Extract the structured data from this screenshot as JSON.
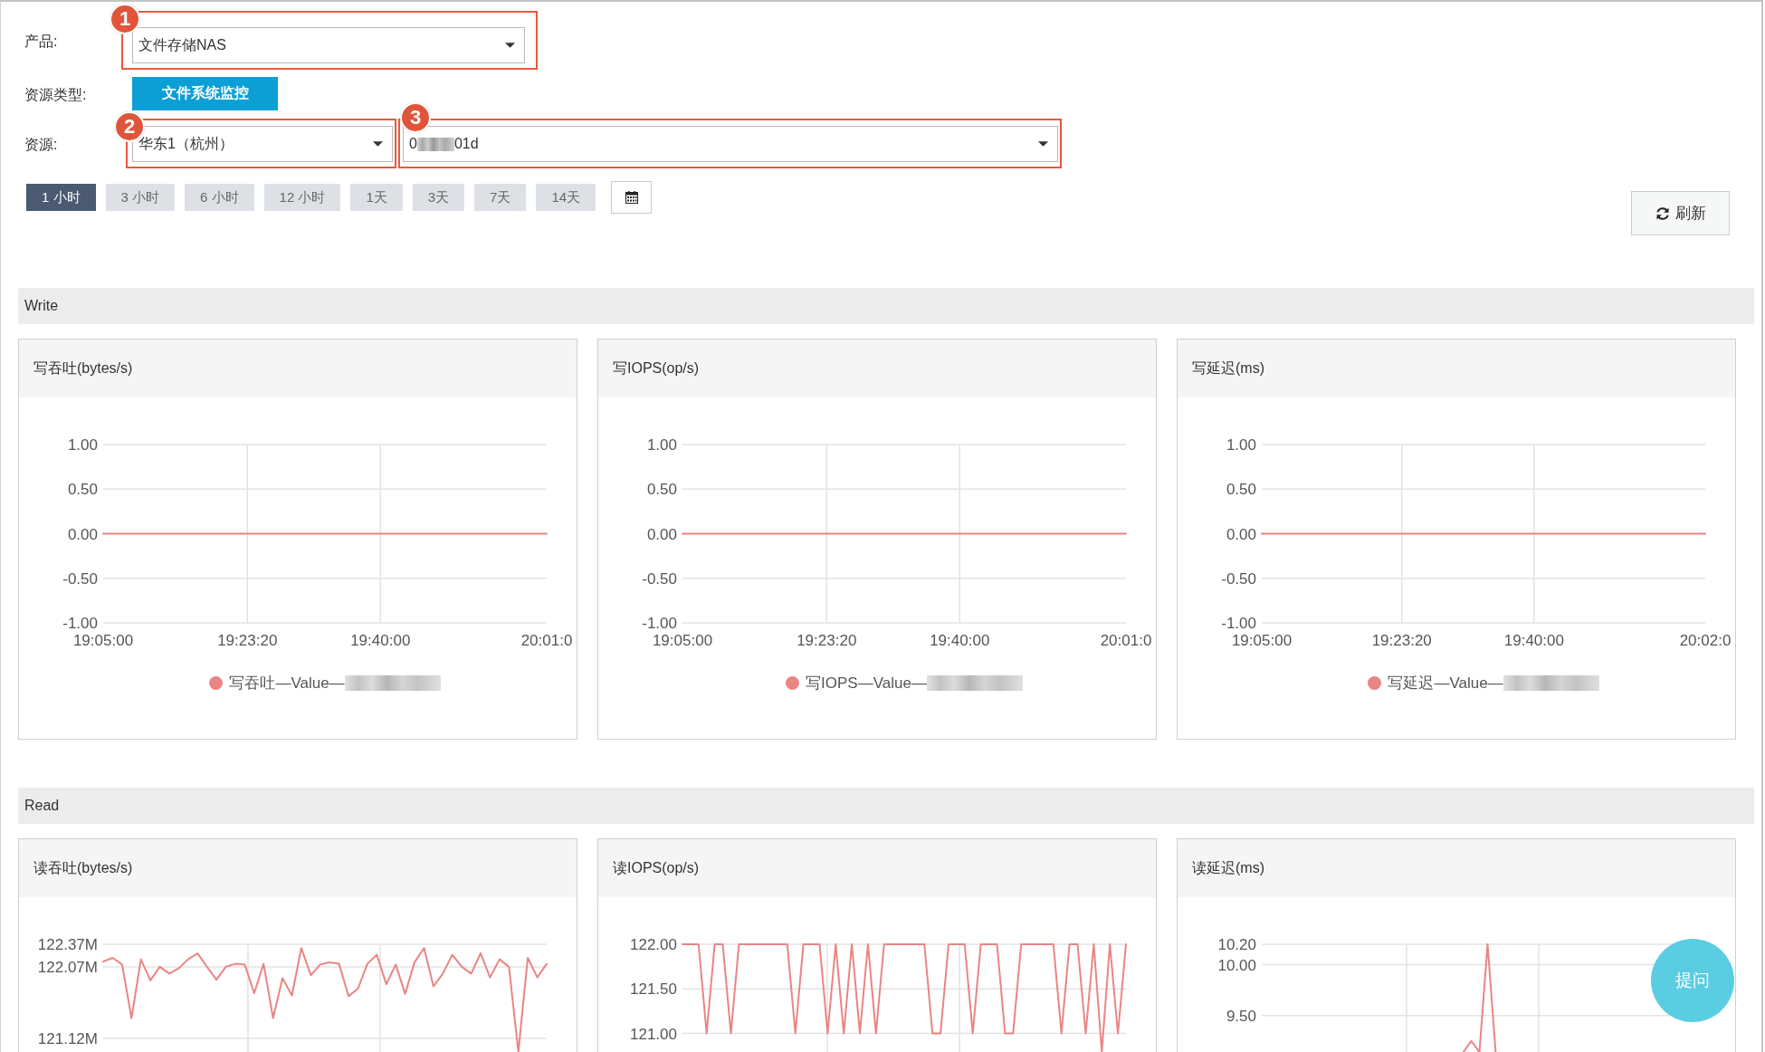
{
  "filters": [
    {
      "label": "产品:",
      "kind": "selects",
      "selects": [
        {
          "value_parts": [
            "文件存储NAS"
          ],
          "annotation": "1"
        }
      ]
    },
    {
      "label": "资源类型:",
      "kind": "button",
      "button": "文件系统监控"
    },
    {
      "label": "资源:",
      "kind": "selects",
      "selects": [
        {
          "value_parts": [
            "华东1（杭州）"
          ],
          "annotation": "2"
        },
        {
          "value_parts": [
            "0",
            "01d"
          ],
          "annotation": "3"
        }
      ]
    }
  ],
  "time_ranges": [
    {
      "label": "1 小时",
      "selected": true
    },
    {
      "label": "3 小时",
      "selected": false
    },
    {
      "label": "6 小时",
      "selected": false
    },
    {
      "label": "12 小时",
      "selected": false
    },
    {
      "label": "1天",
      "selected": false
    },
    {
      "label": "3天",
      "selected": false
    },
    {
      "label": "7天",
      "selected": false
    },
    {
      "label": "14天",
      "selected": false
    }
  ],
  "refresh_button": {
    "label": "刷新"
  },
  "sections": [
    {
      "title": "Write",
      "panels": [
        {
          "title": "写吞吐(bytes/s)",
          "legend_suffix_redacted": true,
          "chart_data": {
            "type": "line",
            "grid": true,
            "categories": [
              "19:05:00",
              null,
              null,
              null,
              null,
              null,
              null,
              null,
              null,
              null,
              null,
              null,
              null,
              "19:23:20",
              null,
              null,
              null,
              null,
              null,
              null,
              null,
              null,
              null,
              null,
              null,
              "19:40:00",
              null,
              null,
              null,
              null,
              null,
              null,
              null,
              null,
              null,
              null,
              null,
              null,
              null,
              null,
              "20:01:0"
            ],
            "ylim": [
              -1,
              1
            ],
            "yticks": [
              {
                "value": 1,
                "label": "1.00"
              },
              {
                "value": 0.5,
                "label": "0.50"
              },
              {
                "value": 0,
                "label": "0.00"
              },
              {
                "value": -0.5,
                "label": "-0.50"
              },
              {
                "value": -1,
                "label": "-1.00"
              }
            ],
            "series": [
              {
                "name": "写吞吐—Value—",
                "color": "#e98583",
                "values": [
                  0,
                  0,
                  0,
                  0,
                  0,
                  0,
                  0,
                  0,
                  0,
                  0,
                  0,
                  0,
                  0,
                  0,
                  0,
                  0,
                  0,
                  0,
                  0,
                  0,
                  0,
                  0,
                  0,
                  0,
                  0,
                  0,
                  0,
                  0,
                  0,
                  0,
                  0,
                  0,
                  0,
                  0,
                  0,
                  0,
                  0,
                  0,
                  0,
                  0,
                  0
                ]
              }
            ]
          }
        },
        {
          "title": "写IOPS(op/s)",
          "legend_suffix_redacted": true,
          "chart_data": {
            "type": "line",
            "grid": true,
            "categories": [
              "19:05:00",
              null,
              null,
              null,
              null,
              null,
              null,
              null,
              null,
              null,
              null,
              null,
              null,
              "19:23:20",
              null,
              null,
              null,
              null,
              null,
              null,
              null,
              null,
              null,
              null,
              null,
              "19:40:00",
              null,
              null,
              null,
              null,
              null,
              null,
              null,
              null,
              null,
              null,
              null,
              null,
              null,
              null,
              "20:01:0"
            ],
            "ylim": [
              -1,
              1
            ],
            "yticks": [
              {
                "value": 1,
                "label": "1.00"
              },
              {
                "value": 0.5,
                "label": "0.50"
              },
              {
                "value": 0,
                "label": "0.00"
              },
              {
                "value": -0.5,
                "label": "-0.50"
              },
              {
                "value": -1,
                "label": "-1.00"
              }
            ],
            "series": [
              {
                "name": "写IOPS—Value—",
                "color": "#e98583",
                "values": [
                  0,
                  0,
                  0,
                  0,
                  0,
                  0,
                  0,
                  0,
                  0,
                  0,
                  0,
                  0,
                  0,
                  0,
                  0,
                  0,
                  0,
                  0,
                  0,
                  0,
                  0,
                  0,
                  0,
                  0,
                  0,
                  0,
                  0,
                  0,
                  0,
                  0,
                  0,
                  0,
                  0,
                  0,
                  0,
                  0,
                  0,
                  0,
                  0,
                  0,
                  0
                ]
              }
            ]
          }
        },
        {
          "title": "写延迟(ms)",
          "legend_suffix_redacted": true,
          "chart_data": {
            "type": "line",
            "grid": true,
            "categories": [
              "19:05:00",
              null,
              null,
              null,
              null,
              null,
              null,
              null,
              null,
              null,
              null,
              null,
              null,
              null,
              null,
              null,
              null,
              null,
              "19:23:20",
              null,
              null,
              null,
              null,
              null,
              null,
              null,
              null,
              null,
              null,
              null,
              null,
              null,
              null,
              null,
              null,
              "19:40:00",
              null,
              null,
              null,
              null,
              null,
              null,
              null,
              null,
              null,
              null,
              null,
              null,
              null,
              null,
              null,
              null,
              null,
              null,
              null,
              null,
              null,
              "20:02:0"
            ],
            "ylim": [
              -1,
              1
            ],
            "yticks": [
              {
                "value": 1,
                "label": "1.00"
              },
              {
                "value": 0.5,
                "label": "0.50"
              },
              {
                "value": 0,
                "label": "0.00"
              },
              {
                "value": -0.5,
                "label": "-0.50"
              },
              {
                "value": -1,
                "label": "-1.00"
              }
            ],
            "series": [
              {
                "name": "写延迟—Value—",
                "color": "#e98583",
                "values": [
                  0,
                  0,
                  0,
                  0,
                  0,
                  0,
                  0,
                  0,
                  0,
                  0,
                  0,
                  0,
                  0,
                  0,
                  0,
                  0,
                  0,
                  0,
                  0,
                  0,
                  0,
                  0,
                  0,
                  0,
                  0,
                  0,
                  0,
                  0,
                  0,
                  0,
                  0,
                  0,
                  0,
                  0,
                  0,
                  0,
                  0,
                  0,
                  0,
                  0,
                  0,
                  0,
                  0,
                  0,
                  0,
                  0,
                  0,
                  0,
                  0,
                  0,
                  0,
                  0,
                  0,
                  0,
                  0,
                  0,
                  0,
                  0
                ]
              }
            ]
          }
        }
      ]
    },
    {
      "title": "Read",
      "panels": [
        {
          "title": "读吞吐(bytes/s)",
          "chart_data": {
            "type": "line",
            "grid": true,
            "ylim": [
              120,
              122.37
            ],
            "yticks": [
              {
                "value": 122.37,
                "label": "122.37M"
              },
              {
                "value": 122.07,
                "label": "122.07M"
              },
              {
                "value": 121.12,
                "label": "121.12M"
              }
            ],
            "series": [
              {
                "color": "#e98583",
                "values": [
                  122.14,
                  122.19,
                  122.1,
                  121.39,
                  122.17,
                  121.89,
                  122.07,
                  121.98,
                  122.05,
                  122.17,
                  122.25,
                  122.07,
                  121.9,
                  122.07,
                  122.11,
                  122.1,
                  121.72,
                  122.11,
                  121.39,
                  121.92,
                  121.69,
                  122.32,
                  121.96,
                  122.1,
                  122.13,
                  122.11,
                  121.68,
                  121.78,
                  122.11,
                  122.23,
                  121.84,
                  122.1,
                  121.71,
                  122.13,
                  122.32,
                  121.81,
                  121.98,
                  122.23,
                  122.07,
                  121.98,
                  122.25,
                  121.93,
                  122.17,
                  122.07,
                  120.94,
                  122.19,
                  121.93,
                  122.11
                ]
              }
            ]
          }
        },
        {
          "title": "读IOPS(op/s)",
          "chart_data": {
            "type": "line",
            "grid": true,
            "ylim": [
              120,
              122
            ],
            "yticks": [
              {
                "value": 122,
                "label": "122.00"
              },
              {
                "value": 121.5,
                "label": "121.50"
              },
              {
                "value": 121,
                "label": "121.00"
              }
            ],
            "series": [
              {
                "color": "#e98583",
                "values": [
                  122,
                  122,
                  122,
                  121,
                  122,
                  122,
                  121,
                  122,
                  122,
                  122,
                  122,
                  122,
                  122,
                  122,
                  121,
                  122,
                  122,
                  122,
                  121,
                  122,
                  121,
                  122,
                  121,
                  122,
                  121,
                  122,
                  122,
                  122,
                  122,
                  122,
                  122,
                  121,
                  121,
                  122,
                  122,
                  122,
                  121,
                  122,
                  122,
                  122,
                  121,
                  121,
                  122,
                  122,
                  122,
                  122,
                  122,
                  121,
                  122,
                  122,
                  121,
                  122,
                  120.79,
                  122,
                  121,
                  122
                ]
              }
            ]
          }
        },
        {
          "title": "读延迟(ms)",
          "chart_data": {
            "type": "line",
            "grid": true,
            "ylim": [
              8.45,
              10.2
            ],
            "yticks": [
              {
                "value": 10.2,
                "label": "10.20"
              },
              {
                "value": 10,
                "label": "10.00"
              },
              {
                "value": 9.5,
                "label": "9.50"
              }
            ],
            "series": [
              {
                "color": "#e98583",
                "values": [
                  null,
                  null,
                  null,
                  null,
                  null,
                  null,
                  null,
                  null,
                  null,
                  null,
                  null,
                  null,
                  null,
                  null,
                  null,
                  null,
                  null,
                  null,
                  null,
                  null,
                  null,
                  null,
                  null,
                  null,
                  null,
                  9.14,
                  9.25,
                  9.14,
                  10.2,
                  9.14,
                  null,
                  null,
                  null,
                  null,
                  null,
                  null,
                  null,
                  null,
                  null,
                  null,
                  null,
                  null,
                  null,
                  null,
                  null,
                  null,
                  null,
                  null,
                  null,
                  null,
                  null,
                  null,
                  null,
                  null,
                  null,
                  null
                ]
              }
            ]
          }
        }
      ]
    }
  ],
  "help_button": {
    "label": "提问"
  }
}
